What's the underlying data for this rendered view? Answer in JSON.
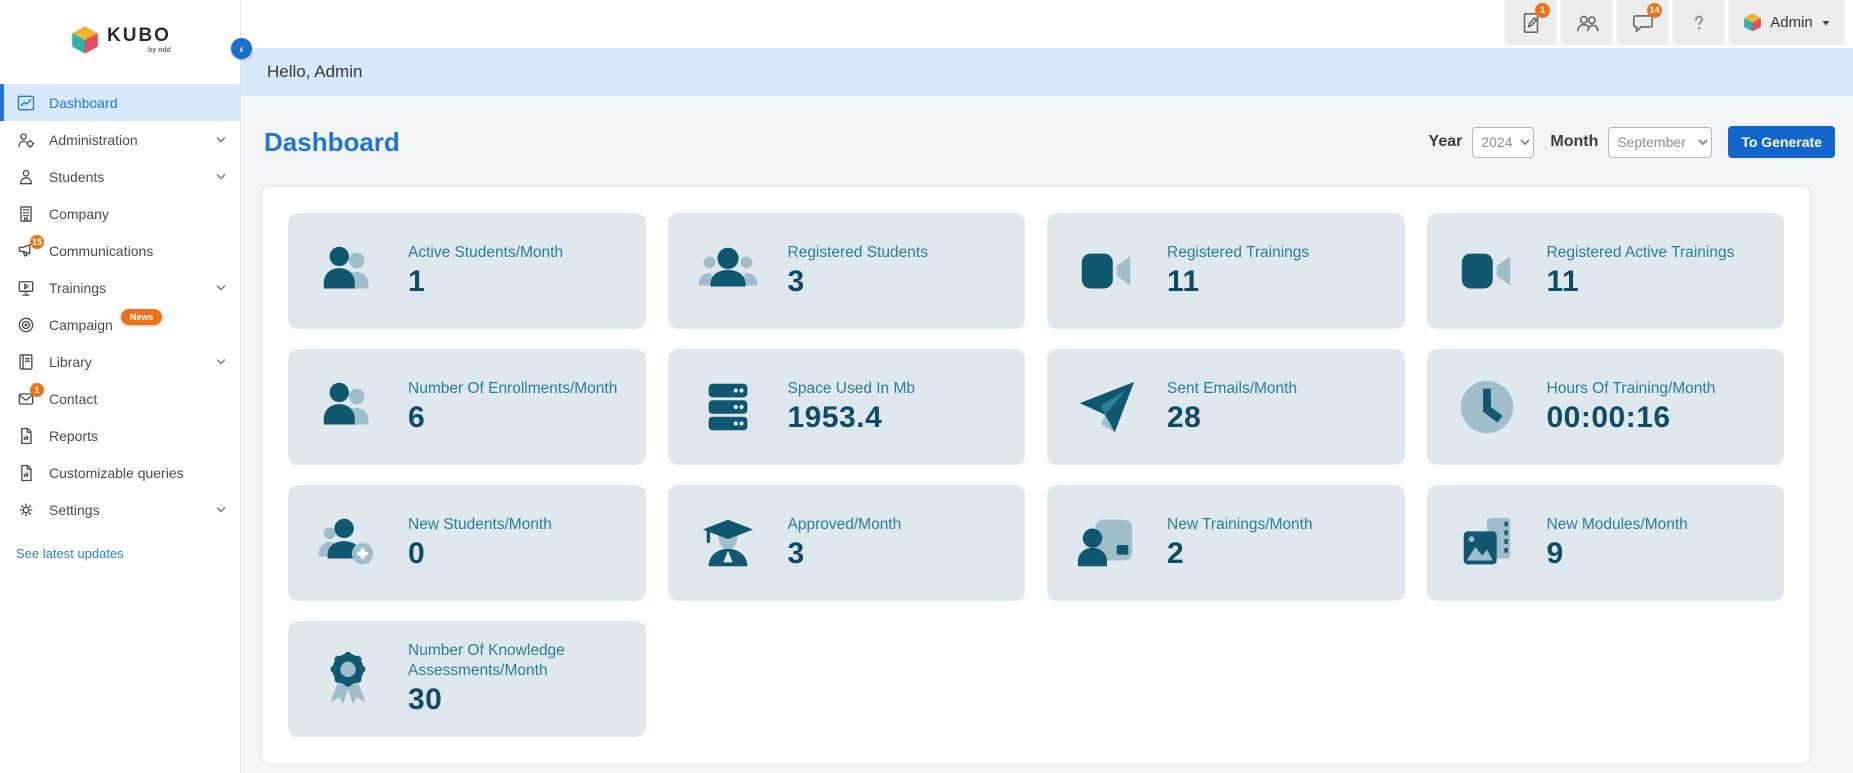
{
  "brand": {
    "name": "KUBO",
    "byline": "by ndd"
  },
  "topbar": {
    "icons": [
      {
        "icon": "compose",
        "name": "compose-icon",
        "badge": "1"
      },
      {
        "icon": "users",
        "name": "users-icon"
      },
      {
        "icon": "chat",
        "name": "chat-icon",
        "badge": "14"
      },
      {
        "icon": "help",
        "name": "help-icon"
      }
    ],
    "user": {
      "label": "Admin"
    }
  },
  "greeting": "Hello, Admin",
  "sidebar": {
    "items": [
      {
        "label": "Dashboard",
        "icon": "chart",
        "active": true
      },
      {
        "label": "Administration",
        "icon": "admin",
        "chevron": true
      },
      {
        "label": "Students",
        "icon": "student",
        "chevron": true
      },
      {
        "label": "Company",
        "icon": "company"
      },
      {
        "label": "Communications",
        "icon": "megaphone",
        "badge": "15"
      },
      {
        "label": "Trainings",
        "icon": "trainings",
        "chevron": true
      },
      {
        "label": "Campaign",
        "icon": "campaign",
        "tag": "News"
      },
      {
        "label": "Library",
        "icon": "library",
        "chevron": true
      },
      {
        "label": "Contact",
        "icon": "contact",
        "badge": "1"
      },
      {
        "label": "Reports",
        "icon": "report"
      },
      {
        "label": "Customizable queries",
        "icon": "report"
      },
      {
        "label": "Settings",
        "icon": "settings",
        "chevron": true
      }
    ],
    "footer_link": "See latest updates"
  },
  "page": {
    "title": "Dashboard",
    "filters": {
      "year_label": "Year",
      "year_value": "2024",
      "month_label": "Month",
      "month_value": "September",
      "generate_button": "To Generate"
    }
  },
  "stats": [
    {
      "title": "Active Students/Month",
      "value": "1",
      "icon": "users2"
    },
    {
      "title": "Registered Students",
      "value": "3",
      "icon": "users3"
    },
    {
      "title": "Registered Trainings",
      "value": "11",
      "icon": "video"
    },
    {
      "title": "Registered Active Trainings",
      "value": "11",
      "icon": "video"
    },
    {
      "title": "Number Of Enrollments/Month",
      "value": "6",
      "icon": "users2"
    },
    {
      "title": "Space Used In Mb",
      "value": "1953.4",
      "icon": "server"
    },
    {
      "title": "Sent Emails/Month",
      "value": "28",
      "icon": "plane"
    },
    {
      "title": "Hours Of Training/Month",
      "value": "00:00:16",
      "icon": "clock"
    },
    {
      "title": "New Students/Month",
      "value": "0",
      "icon": "user-plus"
    },
    {
      "title": "Approved/Month",
      "value": "3",
      "icon": "graduate"
    },
    {
      "title": "New Trainings/Month",
      "value": "2",
      "icon": "trainer"
    },
    {
      "title": "New Modules/Month",
      "value": "9",
      "icon": "modules"
    },
    {
      "title": "Number Of Knowledge Assessments/Month",
      "value": "30",
      "icon": "medal"
    }
  ],
  "colors": {
    "accent_blue": "#2176d2",
    "band_blue": "#d9e9fb",
    "card_bg": "#dfe9ed",
    "stat_title_teal": "#2a7e96",
    "stat_value_navy": "#0e4b66",
    "icon_dark_teal": "#0f5870",
    "icon_light_blue": "#9fbdca",
    "badge_orange": "#ed7117",
    "button_blue": "#1266cb"
  }
}
